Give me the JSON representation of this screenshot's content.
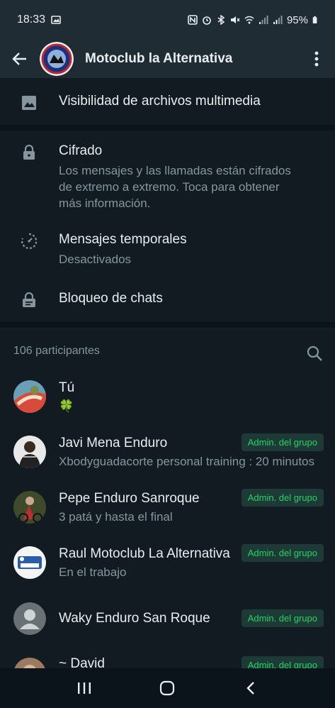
{
  "status_bar": {
    "time": "18:33",
    "battery": "95%"
  },
  "header": {
    "title": "Motoclub la Alternativa"
  },
  "media": {
    "label": "Visibilidad de archivos multimedia"
  },
  "encryption": {
    "title": "Cifrado",
    "description": "Los mensajes y las llamadas están cifrados de extremo a extremo. Toca para obtener más información."
  },
  "disappearing": {
    "title": "Mensajes temporales",
    "status": "Desactivados"
  },
  "chat_lock": {
    "title": "Bloqueo de chats"
  },
  "participants": {
    "header": "106 participantes",
    "members": [
      {
        "name": "Tú",
        "status": "🍀",
        "badge": ""
      },
      {
        "name": "Javi Mena Enduro",
        "status": "Xbodyguadacorte personal training : 20 minutos",
        "badge": "Admin. del grupo"
      },
      {
        "name": "Pepe Enduro Sanroque",
        "status": "3 patá y hasta el final",
        "badge": "Admin. del grupo"
      },
      {
        "name": "Raul Motoclub La Alternativa",
        "status": "En el trabajo",
        "badge": "Admin. del grupo"
      },
      {
        "name": "Waky Enduro San Roque",
        "status": "",
        "badge": "Admin. del grupo"
      },
      {
        "name": "~ David",
        "status": "",
        "badge": "Admin. del grupo"
      }
    ]
  },
  "colors": {
    "background": "#111b21",
    "bar": "#1f2c34",
    "accent": "#25d366",
    "muted_text": "#8696a0"
  }
}
